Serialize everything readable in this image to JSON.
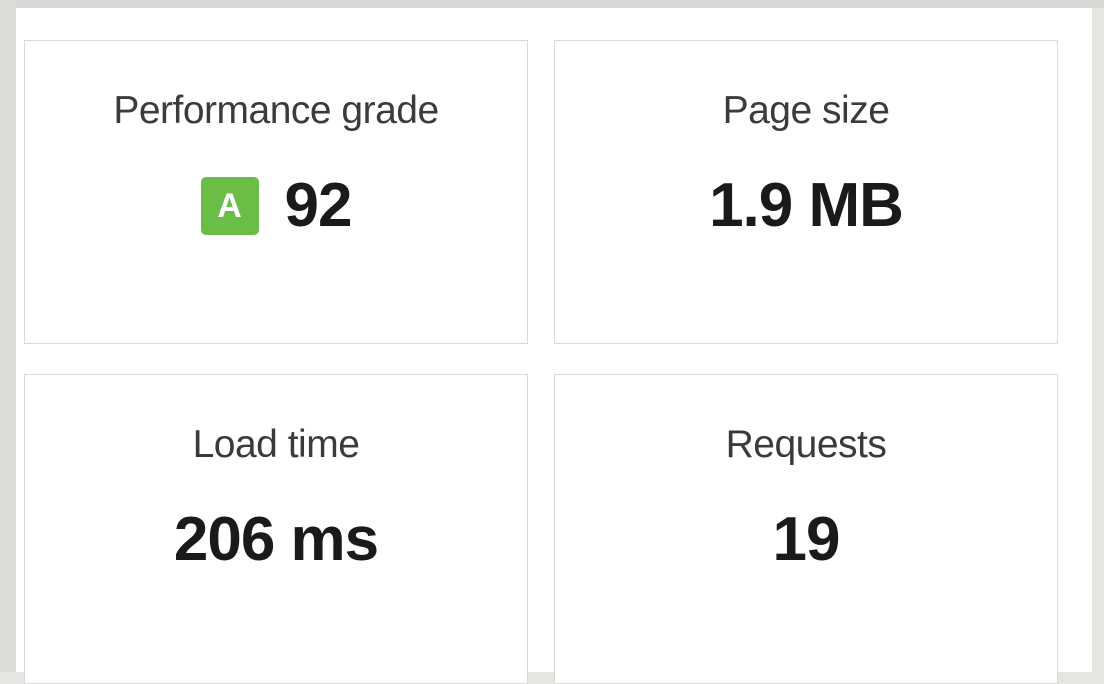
{
  "metrics": {
    "performance": {
      "label": "Performance grade",
      "grade_letter": "A",
      "grade_color": "#6abd45",
      "value": "92"
    },
    "page_size": {
      "label": "Page size",
      "value": "1.9 MB"
    },
    "load_time": {
      "label": "Load time",
      "value": "206 ms"
    },
    "requests": {
      "label": "Requests",
      "value": "19"
    }
  }
}
